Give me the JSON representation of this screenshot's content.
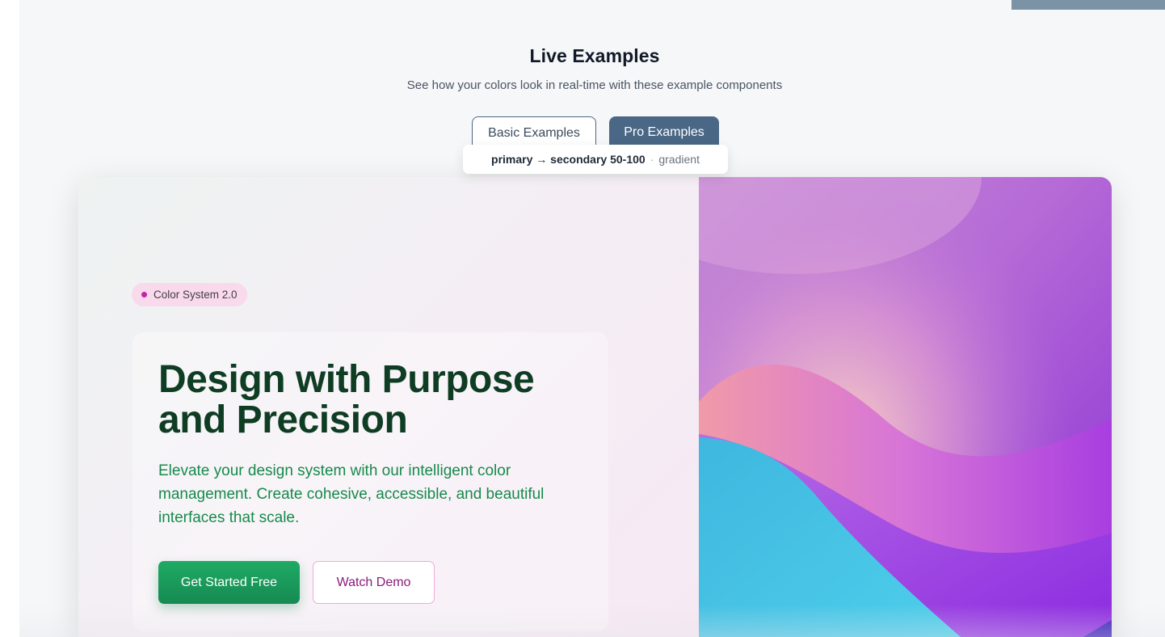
{
  "section": {
    "title": "Live Examples",
    "subtitle": "See how your colors look in real-time with these example components"
  },
  "tabs": [
    {
      "label": "Basic Examples",
      "active": false
    },
    {
      "label": "Pro Examples",
      "active": true
    }
  ],
  "gradient_info": {
    "label": "primary → secondary 50-100",
    "separator": "·",
    "type": "gradient"
  },
  "hero": {
    "badge": "Color System 2.0",
    "headline_line1": "Design with Purpose",
    "headline_line2": "and Precision",
    "description": "Elevate your design system with our intelligent color management. Create cohesive, accessible, and beautiful interfaces that scale.",
    "primary_cta": "Get Started Free",
    "secondary_cta": "Watch Demo"
  },
  "colors": {
    "tab_active_bg": "#4a6786",
    "headline": "#0f3d24",
    "lead_text": "#168a4b",
    "primary_button": "#1faa64",
    "secondary_button_border": "#f0a9d9",
    "secondary_button_text": "#8b1a7a",
    "badge_bg": "#f9d9ec",
    "badge_dot": "#c026a3"
  }
}
